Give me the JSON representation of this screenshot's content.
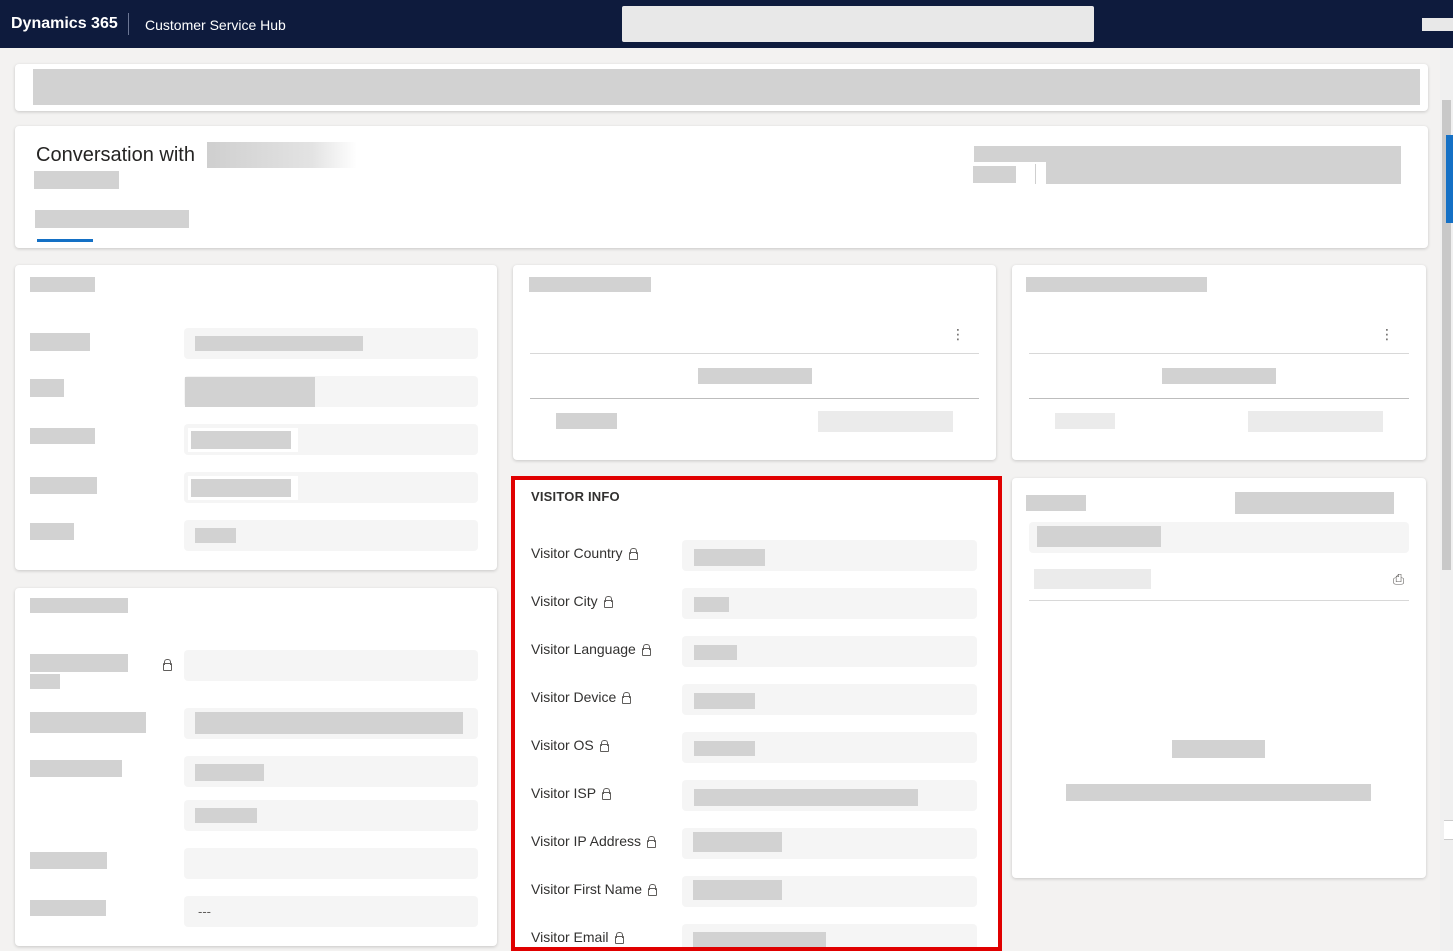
{
  "topbar": {
    "brand": "Dynamics 365",
    "app_name": "Customer Service Hub"
  },
  "header": {
    "title_prefix": "Conversation with"
  },
  "visitor_info": {
    "title": "VISITOR INFO",
    "fields": [
      {
        "label": "Visitor Country"
      },
      {
        "label": "Visitor City"
      },
      {
        "label": "Visitor Language"
      },
      {
        "label": "Visitor Device"
      },
      {
        "label": "Visitor OS"
      },
      {
        "label": "Visitor ISP"
      },
      {
        "label": "Visitor IP Address"
      },
      {
        "label": "Visitor First Name"
      },
      {
        "label": "Visitor Email"
      }
    ]
  },
  "left_bottom_card": {
    "empty_value": "---"
  },
  "colors": {
    "topbar": "#0e1b3d",
    "accent": "#1470c5",
    "highlight": "#e00000"
  }
}
